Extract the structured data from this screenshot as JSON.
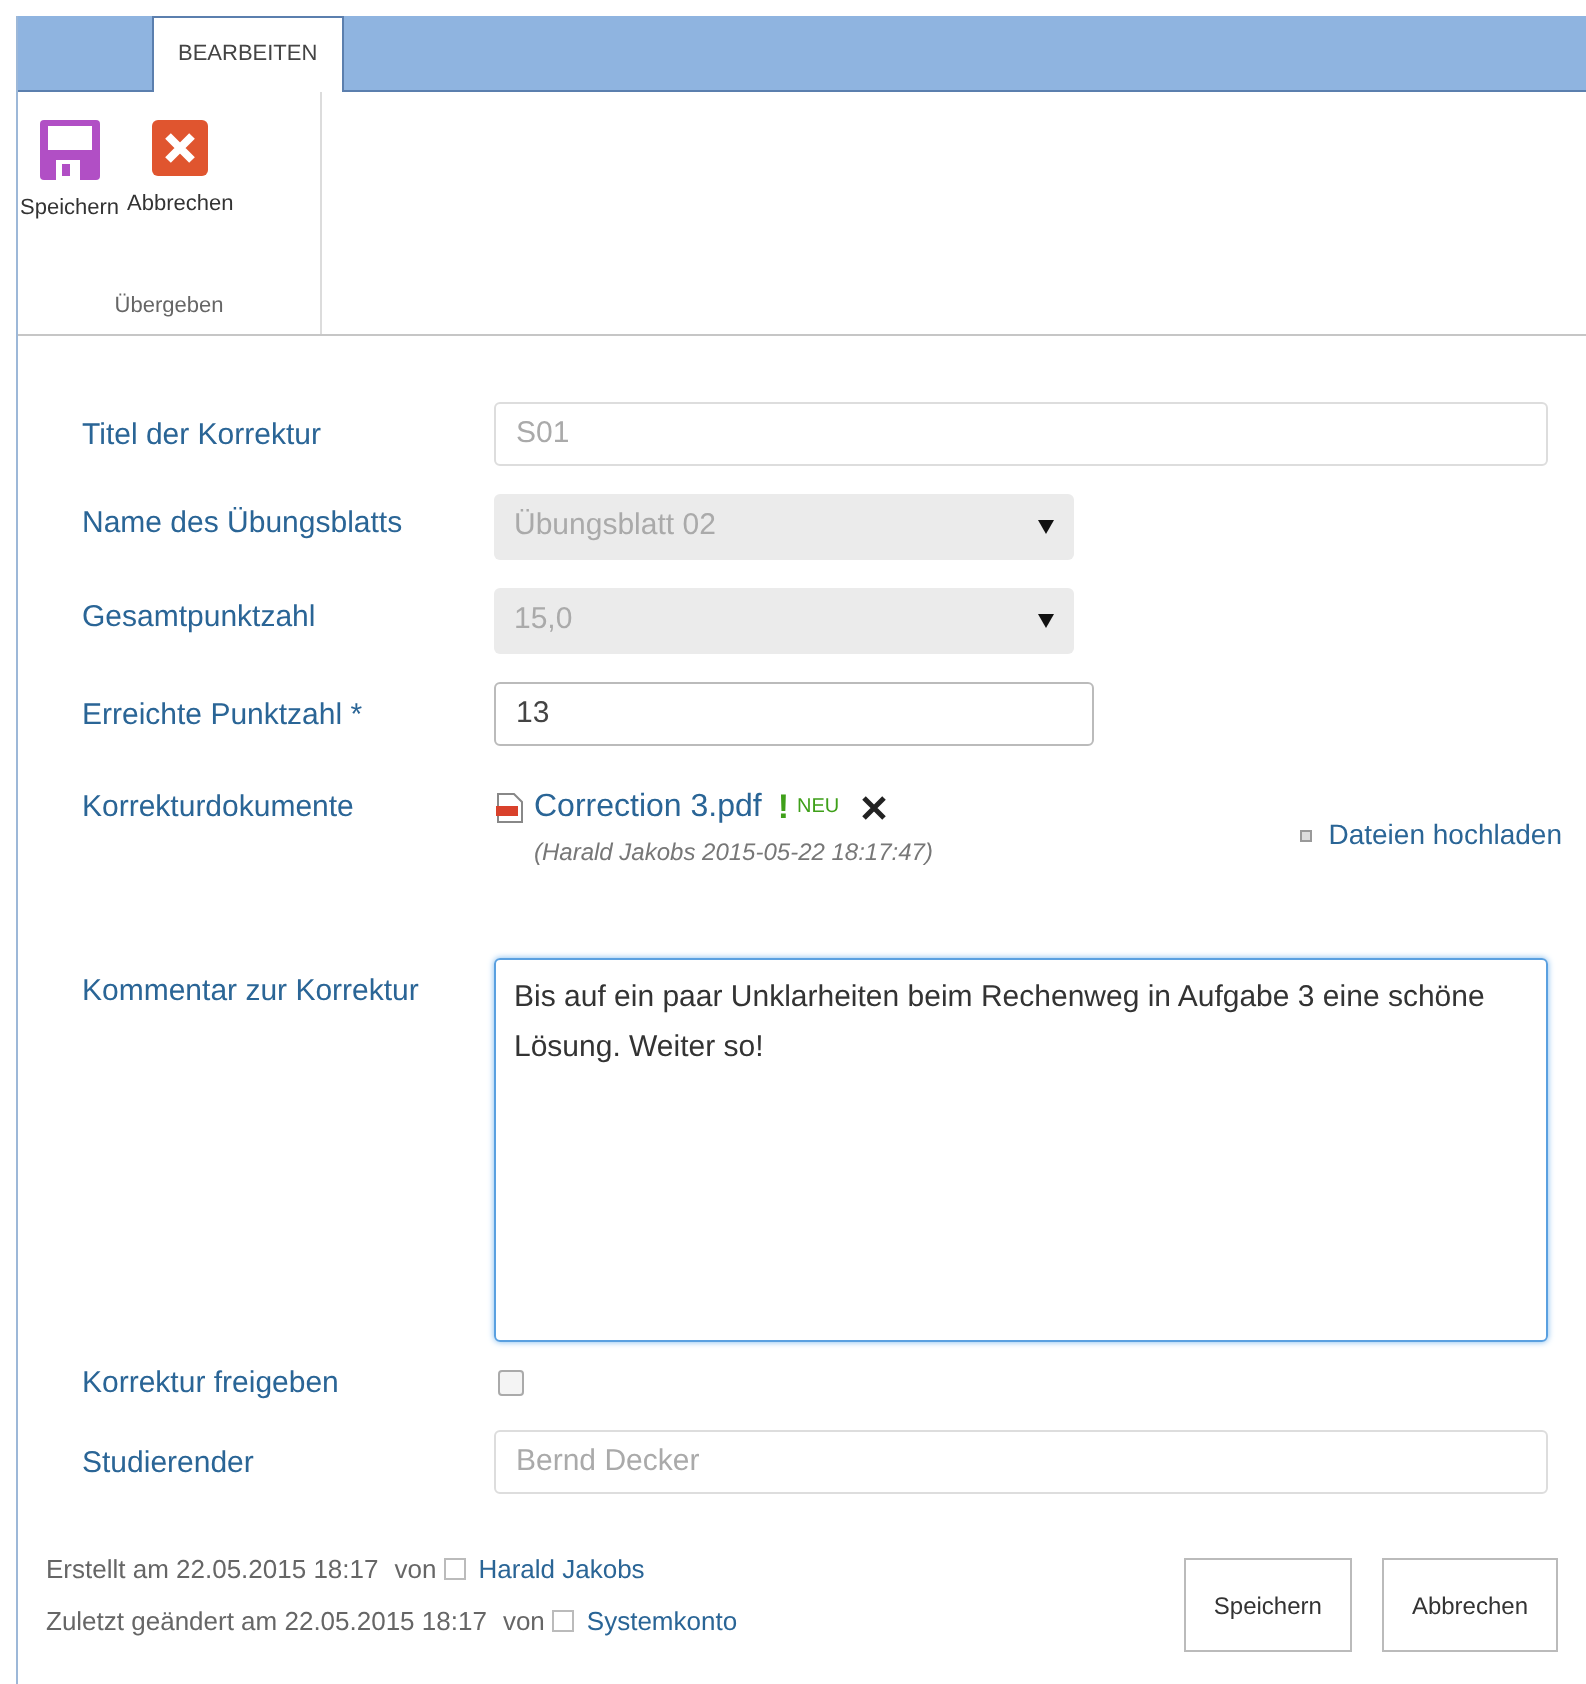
{
  "ribbon": {
    "tabs": [
      {
        "label": "BEARBEITEN",
        "selected": true
      }
    ],
    "buttons": [
      {
        "kind": "save",
        "label": "Speichern"
      },
      {
        "kind": "cancel",
        "label": "Abbrechen"
      }
    ],
    "group_label": "Übergeben"
  },
  "form": {
    "fields": [
      {
        "kind": "text",
        "label": "Titel der Korrektur",
        "value": "S01",
        "disabled": true
      },
      {
        "kind": "select",
        "label": "Name des Übungsblatts",
        "value": "Übungsblatt 02",
        "disabled": true
      },
      {
        "kind": "select",
        "label": "Gesamtpunktzahl",
        "value": "15,0",
        "disabled": true
      },
      {
        "kind": "text",
        "label": "Erreichte Punktzahl *",
        "value": "13",
        "disabled": false
      },
      {
        "kind": "files",
        "label": "Korrekturdokumente",
        "files": [
          {
            "name": "Correction 3.pdf",
            "mark": "!",
            "badge": "NEU",
            "meta": "(Harald Jakobs 2015-05-22 18:17:47)"
          }
        ],
        "upload_link": "Dateien hochladen"
      },
      {
        "kind": "textarea",
        "label": "Kommentar zur Korrektur",
        "value": "Bis auf ein paar Unklarheiten beim Rechenweg in Aufgabe 3 eine schöne Lösung. Weiter so!"
      },
      {
        "kind": "checkbox",
        "label": "Korrektur freigeben",
        "checked": false
      },
      {
        "kind": "text",
        "label": "Studierender",
        "value": "Bernd Decker",
        "disabled": true
      }
    ]
  },
  "footer": {
    "lines": [
      {
        "text": "Erstellt am 22.05.2015 18:17",
        "by": "von",
        "user": "Harald Jakobs"
      },
      {
        "text": "Zuletzt geändert am 22.05.2015 18:17",
        "by": "von",
        "user": "Systemkonto"
      }
    ],
    "buttons": [
      "Speichern",
      "Abbrechen"
    ]
  }
}
